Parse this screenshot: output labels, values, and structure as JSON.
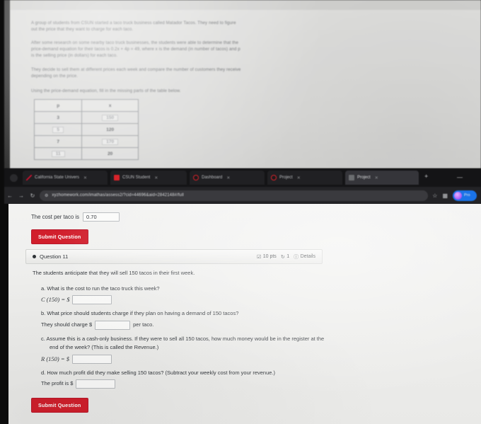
{
  "worksheet": {
    "paragraphs": [
      "A group of students from CSUN started a taco truck business called Matador Tacos. They need to figure out the price that they want to charge for each taco.",
      "After some research on some nearby taco truck businesses, the students were able to determine that the price-demand equation for their tacos is 0.2x + 4p = 49, where x is the demand (in number of tacos) and p is the selling price (in dollars) for each taco.",
      "They decide to sell them at different prices each week and compare the number of customers they receive depending on the price.",
      "Using the price-demand equation, fill in the missing parts of the table below."
    ],
    "table": {
      "headers": [
        "p",
        "x"
      ],
      "rows": [
        {
          "p": "3",
          "x": "150",
          "p_given": true,
          "x_given": false
        },
        {
          "p": "5",
          "x": "120",
          "p_given": false,
          "x_given": true
        },
        {
          "p": "7",
          "x": "170",
          "p_given": true,
          "x_given": false
        },
        {
          "p": "11",
          "x": "20",
          "p_given": false,
          "x_given": true
        }
      ]
    }
  },
  "browser": {
    "tabs": [
      {
        "title": "California State Univers",
        "favicon": "csun-n-icon",
        "active": false
      },
      {
        "title": "CSUN Student",
        "favicon": "red-square-icon",
        "active": false
      },
      {
        "title": "Dashboard",
        "favicon": "red-ring-icon",
        "active": false
      },
      {
        "title": "Project",
        "favicon": "red-ring-icon",
        "active": false
      },
      {
        "title": "Project",
        "favicon": "gray-square-icon",
        "active": true
      }
    ],
    "new_tab_label": "+",
    "minimize_label": "—",
    "nav": {
      "back": "←",
      "forward": "→",
      "reload": "↻"
    },
    "omnibox": {
      "lock_icon": "site-info-icon",
      "url": "xyzhomework.com/imathas/assess2/?cid=44696&aid=2842148#/full"
    },
    "actions": {
      "bookmark": "☆",
      "extensions": "extension-icon",
      "profile_label": "Pro"
    }
  },
  "page": {
    "cost_row": {
      "label": "The cost per taco is",
      "value": "0.70"
    },
    "submit_top_label": "Submit Question",
    "submit_bottom_label": "Submit Question",
    "question": {
      "title": "Question 11",
      "points": "10 pts",
      "attempts": "1",
      "details": "Details",
      "intro": "The students anticipate that they will sell 150 tacos in their first week.",
      "parts": [
        {
          "label": "a.",
          "prompt": "What is the cost to run the taco truck this week?",
          "answer_prefix": "C (150) = $",
          "answer_value": ""
        },
        {
          "label": "b.",
          "prompt": "What price should students charge if they plan on having a demand of 150 tacos?",
          "answer_prefix": "They should charge $",
          "answer_suffix": "per taco.",
          "answer_value": ""
        },
        {
          "label": "c.",
          "prompt": "Assume this is a cash-only business. If they were to sell all 150 tacos, how much money would be in the register at the end of the week? (This is called the Revenue.)",
          "answer_prefix": "R (150) = $",
          "answer_value": ""
        },
        {
          "label": "d.",
          "prompt": "How much profit did they make selling 150 tacos? (Subtract your weekly cost from your revenue.)",
          "answer_prefix": "The profit is $",
          "answer_value": ""
        }
      ]
    }
  },
  "colors": {
    "submit_red": "#d11f2c",
    "profile_blue": "#1a73e8",
    "page_bg": "#eeeeec",
    "chrome_bg": "#1b1b1d"
  }
}
